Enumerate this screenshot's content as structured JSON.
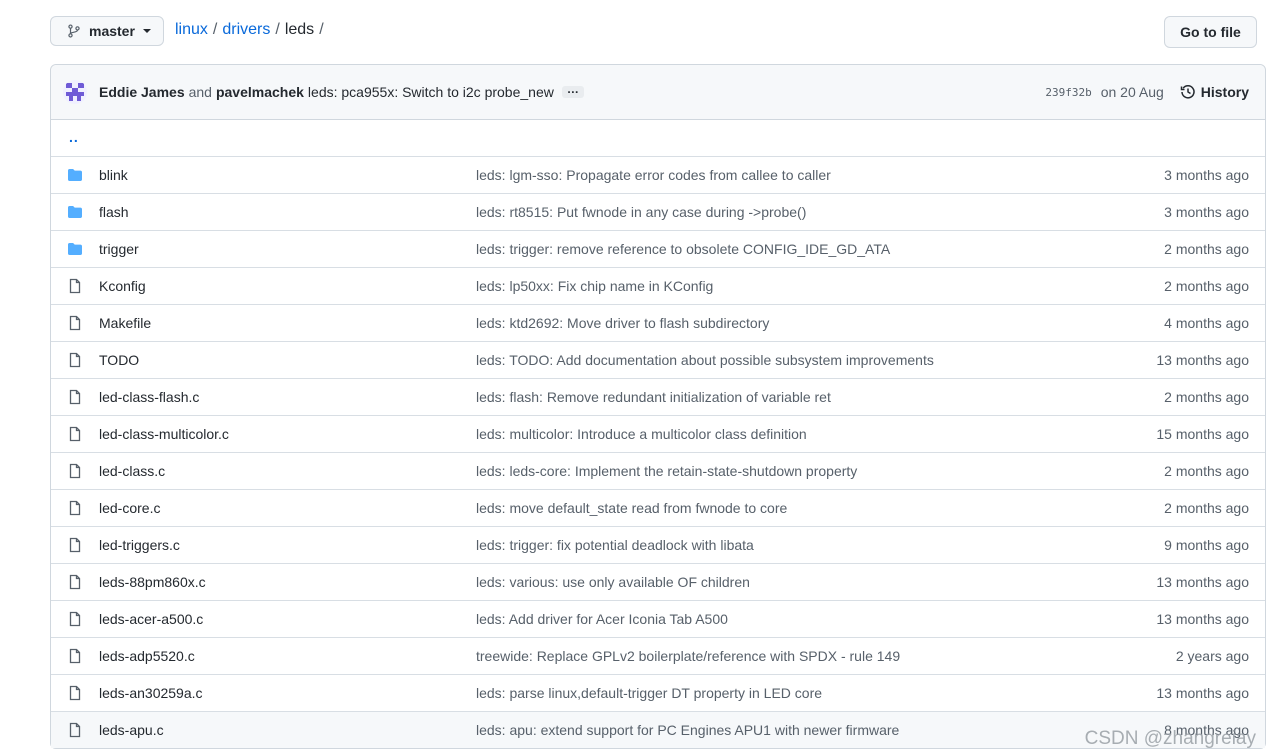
{
  "branch": {
    "label": "master"
  },
  "breadcrumb": {
    "parts": [
      "linux",
      "drivers"
    ],
    "current": "leds",
    "separator": "/"
  },
  "goto_file": {
    "label": "Go to file"
  },
  "latest_commit": {
    "author1": "Eddie James",
    "and": "and",
    "author2": "pavelmachek",
    "message": "leds: pca955x: Switch to i2c probe_new",
    "ellipsis": "…",
    "sha": "239f32b",
    "date": "on 20 Aug",
    "history_label": "History"
  },
  "parent_dir": "..",
  "files": [
    {
      "name": "blink",
      "type": "dir",
      "message": "leds: lgm-sso: Propagate error codes from callee to caller",
      "age": "3 months ago"
    },
    {
      "name": "flash",
      "type": "dir",
      "message": "leds: rt8515: Put fwnode in any case during ->probe()",
      "age": "3 months ago"
    },
    {
      "name": "trigger",
      "type": "dir",
      "message": "leds: trigger: remove reference to obsolete CONFIG_IDE_GD_ATA",
      "age": "2 months ago"
    },
    {
      "name": "Kconfig",
      "type": "file",
      "message": "leds: lp50xx: Fix chip name in KConfig",
      "age": "2 months ago"
    },
    {
      "name": "Makefile",
      "type": "file",
      "message": "leds: ktd2692: Move driver to flash subdirectory",
      "age": "4 months ago"
    },
    {
      "name": "TODO",
      "type": "file",
      "message": "leds: TODO: Add documentation about possible subsystem improvements",
      "age": "13 months ago"
    },
    {
      "name": "led-class-flash.c",
      "type": "file",
      "message": "leds: flash: Remove redundant initialization of variable ret",
      "age": "2 months ago"
    },
    {
      "name": "led-class-multicolor.c",
      "type": "file",
      "message": "leds: multicolor: Introduce a multicolor class definition",
      "age": "15 months ago"
    },
    {
      "name": "led-class.c",
      "type": "file",
      "message": "leds: leds-core: Implement the retain-state-shutdown property",
      "age": "2 months ago"
    },
    {
      "name": "led-core.c",
      "type": "file",
      "message": "leds: move default_state read from fwnode to core",
      "age": "2 months ago"
    },
    {
      "name": "led-triggers.c",
      "type": "file",
      "message": "leds: trigger: fix potential deadlock with libata",
      "age": "9 months ago"
    },
    {
      "name": "leds-88pm860x.c",
      "type": "file",
      "message": "leds: various: use only available OF children",
      "age": "13 months ago"
    },
    {
      "name": "leds-acer-a500.c",
      "type": "file",
      "message": "leds: Add driver for Acer Iconia Tab A500",
      "age": "13 months ago"
    },
    {
      "name": "leds-adp5520.c",
      "type": "file",
      "message": "treewide: Replace GPLv2 boilerplate/reference with SPDX - rule 149",
      "age": "2 years ago"
    },
    {
      "name": "leds-an30259a.c",
      "type": "file",
      "message": "leds: parse linux,default-trigger DT property in LED core",
      "age": "13 months ago"
    },
    {
      "name": "leds-apu.c",
      "type": "file",
      "message": "leds: apu: extend support for PC Engines APU1 with newer firmware",
      "age": "8 months ago"
    }
  ],
  "watermark": "CSDN @zhangreiay",
  "colors": {
    "link": "#0969da",
    "folder": "#54aeff",
    "muted": "#57606a",
    "border": "#d0d7de"
  }
}
